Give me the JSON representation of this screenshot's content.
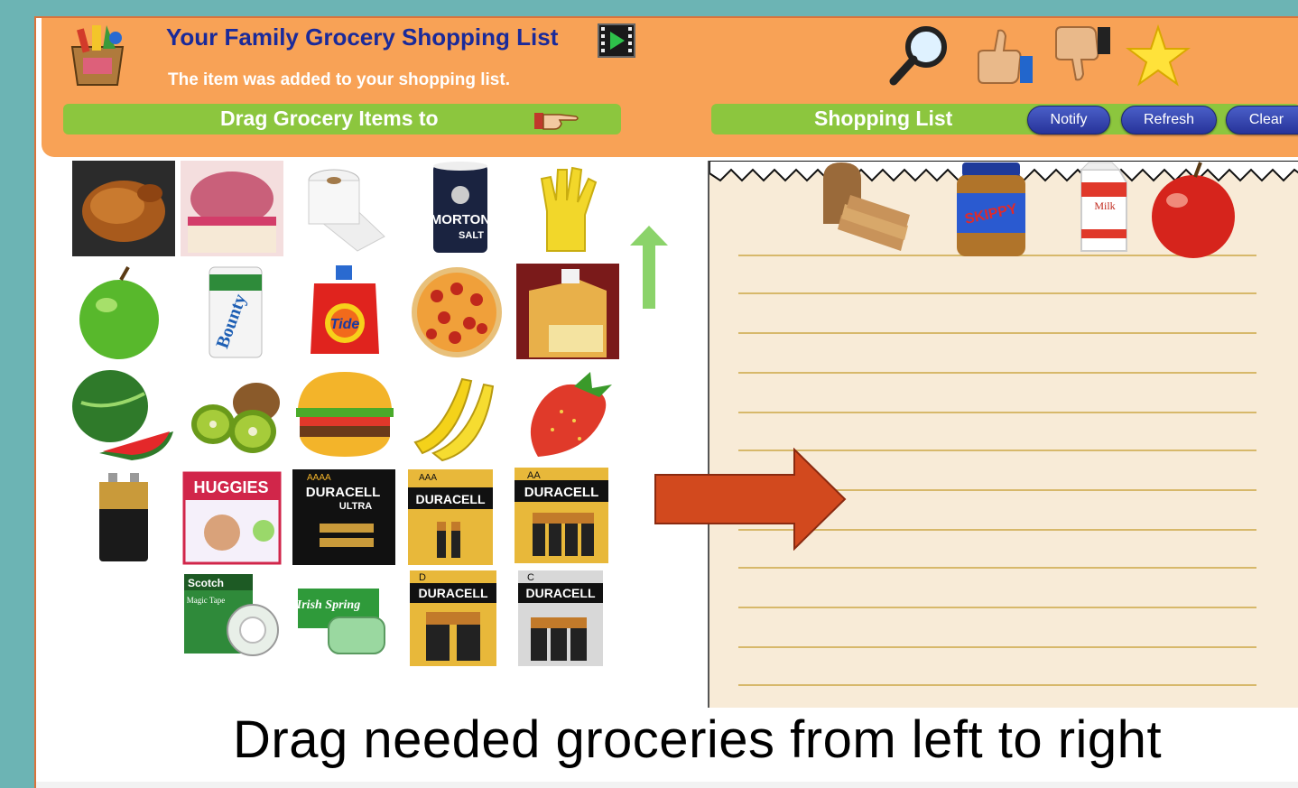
{
  "header": {
    "title": "Your Family Grocery Shopping List",
    "status_message": "The item was added to your shopping list.",
    "left_bar_label": "Drag Grocery Items to",
    "right_bar_label": "Shopping List",
    "buttons": {
      "notify": "Notify",
      "refresh": "Refresh",
      "clear": "Clear"
    },
    "icons": [
      "grocery-bag-icon",
      "video-icon",
      "search-icon",
      "thumbs-up-icon",
      "thumbs-down-icon",
      "star-icon",
      "pointing-hand-icon"
    ]
  },
  "grocery_items": [
    [
      "roast-chicken",
      "ice-cream",
      "toilet-paper",
      "salt",
      "rubber-gloves"
    ],
    [
      "green-apple",
      "paper-towels",
      "laundry-detergent",
      "pizza",
      "cooking-oil"
    ],
    [
      "watermelon",
      "kiwi",
      "hamburger",
      "bananas",
      "strawberry"
    ],
    [
      "9v-battery",
      "diapers",
      "aaaa-batteries",
      "aaa-batteries",
      "aa-batteries"
    ],
    [
      "tape",
      "soap",
      "d-batteries",
      "c-batteries"
    ]
  ],
  "product_labels": {
    "salt_brand": "MORTON",
    "salt_word": "SALT",
    "towel_brand": "Bounty",
    "detergent_brand": "Tide",
    "diaper_brand": "HUGGIES",
    "battery_brand": "DURACELL",
    "battery_sizes": {
      "aaaa": "AAAA",
      "aaa": "AAA",
      "aa": "AA",
      "d": "D",
      "c": "C"
    },
    "ultra": "ULTRA",
    "tape_brand": "Scotch",
    "tape_name": "Magic Tape",
    "soap_brand": "Irish Spring"
  },
  "shopping_list": {
    "items": [
      "bread",
      "peanut-butter",
      "milk",
      "red-apple"
    ],
    "peanut_butter_brand": "SKIPPY",
    "milk_label": "Milk"
  },
  "caption": "Drag needed groceries from left to right",
  "colors": {
    "background": "#6cb4b4",
    "header": "#f8a256",
    "bar_green": "#8cc63e",
    "title_blue": "#1a2a9a",
    "button_blue": "#3545b0",
    "arrow_red": "#d2491e"
  }
}
